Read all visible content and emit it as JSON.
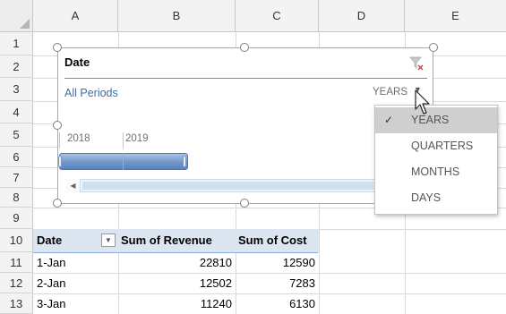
{
  "columns": [
    "A",
    "B",
    "C",
    "D",
    "E"
  ],
  "rows": [
    "1",
    "2",
    "3",
    "4",
    "5",
    "6",
    "7",
    "8",
    "9",
    "10",
    "11",
    "12",
    "13"
  ],
  "slicer": {
    "title": "Date",
    "period_label": "All Periods",
    "level_label": "YEARS",
    "level_caret": "▼",
    "years": [
      "2018",
      "2019"
    ],
    "clear_filter_icon": "filter-clear-icon",
    "scroll_left_icon": "◀"
  },
  "level_menu": {
    "items": [
      {
        "label": "YEARS",
        "selected": true
      },
      {
        "label": "QUARTERS",
        "selected": false
      },
      {
        "label": "MONTHS",
        "selected": false
      },
      {
        "label": "DAYS",
        "selected": false
      }
    ],
    "check_mark": "✓"
  },
  "pivot": {
    "headers": [
      "Date",
      "Sum of Revenue",
      "Sum of Cost"
    ],
    "filter_button": "▼",
    "rows": [
      {
        "date": "1-Jan",
        "revenue": "22810",
        "cost": "12590"
      },
      {
        "date": "2-Jan",
        "revenue": "12502",
        "cost": "7283"
      },
      {
        "date": "3-Jan",
        "revenue": "11240",
        "cost": "6130"
      }
    ]
  },
  "colors": {
    "accent": "#5b8ccb",
    "header_fill": "#dce6f1",
    "bar": "#6f95c9"
  }
}
